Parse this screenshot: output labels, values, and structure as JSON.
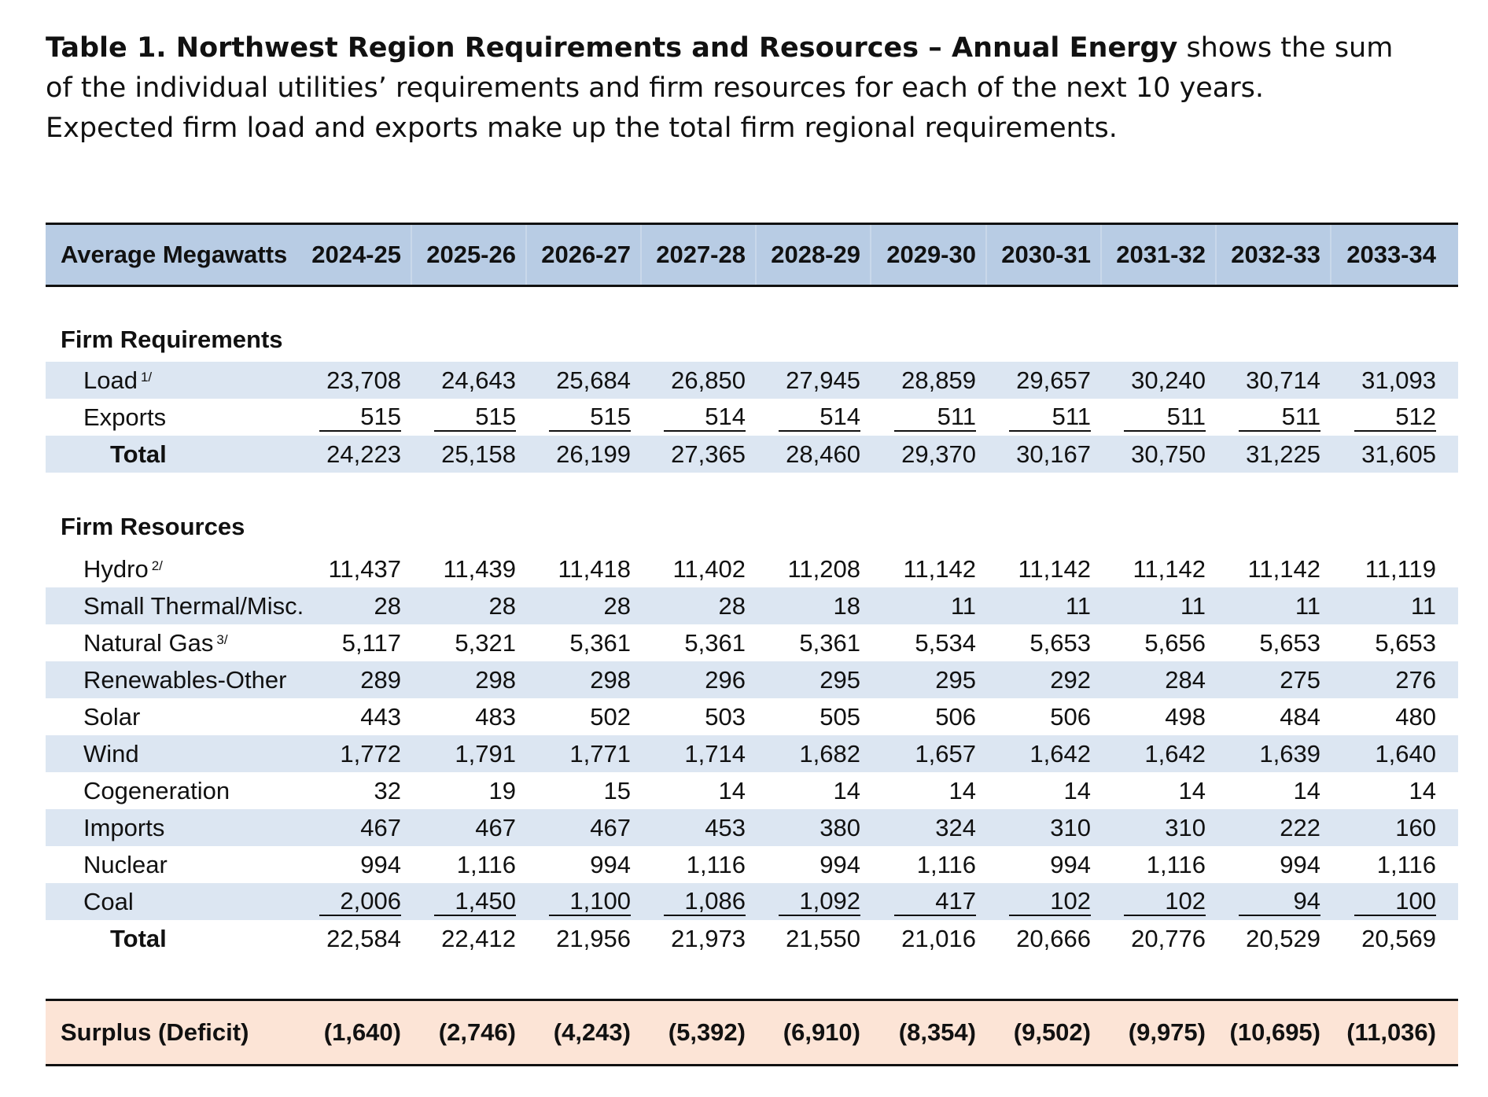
{
  "intro": {
    "title": "Table 1. Northwest Region Requirements and Resources – Annual Energy",
    "text": " shows the sum of the individual utilities’ requirements and firm resources for each of the next 10 years.  Expected firm load and exports make up the total firm regional requirements."
  },
  "table": {
    "header_label": "Average Megawatts",
    "years": [
      "2024-25",
      "2025-26",
      "2026-27",
      "2027-28",
      "2028-29",
      "2029-30",
      "2030-31",
      "2031-32",
      "2032-33",
      "2033-34"
    ],
    "requirements": {
      "section_label": "Firm Requirements",
      "rows": [
        {
          "label": "Load",
          "note": "1/",
          "values": [
            "23,708",
            "24,643",
            "25,684",
            "26,850",
            "27,945",
            "28,859",
            "29,657",
            "30,240",
            "30,714",
            "31,093"
          ]
        },
        {
          "label": "Exports",
          "note": "",
          "values": [
            "515",
            "515",
            "515",
            "514",
            "514",
            "511",
            "511",
            "511",
            "511",
            "512"
          ]
        },
        {
          "label": "Total",
          "note": "",
          "values": [
            "24,223",
            "25,158",
            "26,199",
            "27,365",
            "28,460",
            "29,370",
            "30,167",
            "30,750",
            "31,225",
            "31,605"
          ]
        }
      ]
    },
    "resources": {
      "section_label": "Firm Resources",
      "rows": [
        {
          "label": "Hydro",
          "note": "2/",
          "values": [
            "11,437",
            "11,439",
            "11,418",
            "11,402",
            "11,208",
            "11,142",
            "11,142",
            "11,142",
            "11,142",
            "11,119"
          ]
        },
        {
          "label": "Small Thermal/Misc.",
          "note": "",
          "values": [
            "28",
            "28",
            "28",
            "28",
            "18",
            "11",
            "11",
            "11",
            "11",
            "11"
          ]
        },
        {
          "label": "Natural Gas",
          "note": "3/",
          "values": [
            "5,117",
            "5,321",
            "5,361",
            "5,361",
            "5,361",
            "5,534",
            "5,653",
            "5,656",
            "5,653",
            "5,653"
          ]
        },
        {
          "label": "Renewables-Other",
          "note": "",
          "values": [
            "289",
            "298",
            "298",
            "296",
            "295",
            "295",
            "292",
            "284",
            "275",
            "276"
          ]
        },
        {
          "label": "Solar",
          "note": "",
          "values": [
            "443",
            "483",
            "502",
            "503",
            "505",
            "506",
            "506",
            "498",
            "484",
            "480"
          ]
        },
        {
          "label": "Wind",
          "note": "",
          "values": [
            "1,772",
            "1,791",
            "1,771",
            "1,714",
            "1,682",
            "1,657",
            "1,642",
            "1,642",
            "1,639",
            "1,640"
          ]
        },
        {
          "label": "Cogeneration",
          "note": "",
          "values": [
            "32",
            "19",
            "15",
            "14",
            "14",
            "14",
            "14",
            "14",
            "14",
            "14"
          ]
        },
        {
          "label": "Imports",
          "note": "",
          "values": [
            "467",
            "467",
            "467",
            "453",
            "380",
            "324",
            "310",
            "310",
            "222",
            "160"
          ]
        },
        {
          "label": "Nuclear",
          "note": "",
          "values": [
            "994",
            "1,116",
            "994",
            "1,116",
            "994",
            "1,116",
            "994",
            "1,116",
            "994",
            "1,116"
          ]
        },
        {
          "label": "Coal",
          "note": "",
          "values": [
            "2,006",
            "1,450",
            "1,100",
            "1,086",
            "1,092",
            "417",
            "102",
            "102",
            "94",
            "100"
          ]
        },
        {
          "label": "Total",
          "note": "",
          "values": [
            "22,584",
            "22,412",
            "21,956",
            "21,973",
            "21,550",
            "21,016",
            "20,666",
            "20,776",
            "20,529",
            "20,569"
          ]
        }
      ]
    },
    "surplus": {
      "label": "Surplus (Deficit)",
      "values": [
        "(1,640)",
        "(2,746)",
        "(4,243)",
        "(5,392)",
        "(6,910)",
        "(8,354)",
        "(9,502)",
        "(9,975)",
        "(10,695)",
        "(11,036)"
      ]
    }
  }
}
